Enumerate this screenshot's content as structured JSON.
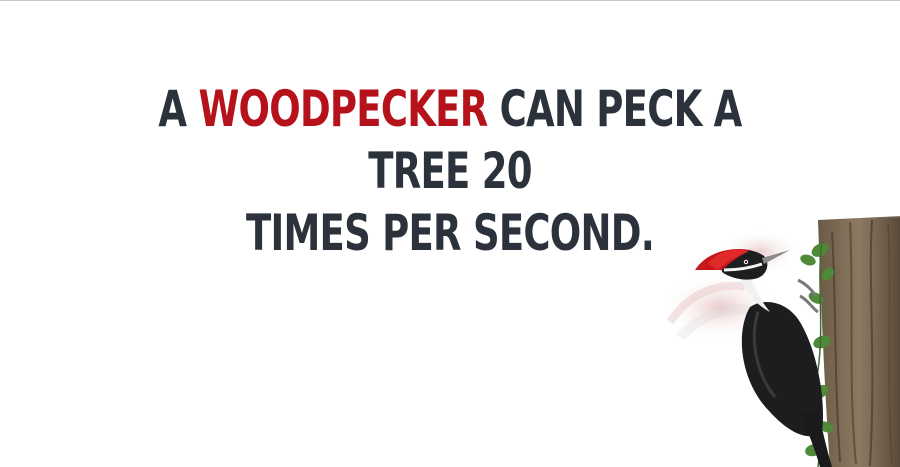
{
  "headline": {
    "part_before": "A ",
    "accent_word": "WOODPECKER",
    "part_after_line1": " CAN PECK A TREE 20",
    "line2": "TIMES PER SECOND."
  },
  "colors": {
    "text": "#2b323c",
    "accent": "#b5121b",
    "background": "#ffffff"
  },
  "illustration": {
    "icon": "woodpecker-on-tree-icon"
  }
}
